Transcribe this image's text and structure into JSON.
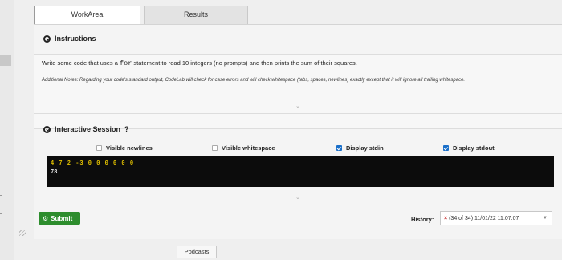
{
  "tabs": [
    {
      "label": "WorkArea",
      "active": true
    },
    {
      "label": "Results",
      "active": false
    }
  ],
  "instructions": {
    "header": "Instructions",
    "text_before": "Write some code that uses a ",
    "code_word": "for",
    "text_after": " statement to read 10 integers (no prompts) and then prints the sum of their squares.",
    "notes": "Additional Notes: Regarding your code's standard output, CodeLab will check for case errors and will check whitespace (tabs, spaces, newlines) exactly except that it will ignore all trailing whitespace."
  },
  "session": {
    "header": "Interactive Session",
    "help": "?",
    "options": [
      {
        "label": "Visible newlines",
        "checked": false
      },
      {
        "label": "Visible whitespace",
        "checked": false
      },
      {
        "label": "Display stdin",
        "checked": true
      },
      {
        "label": "Display stdout",
        "checked": true
      }
    ],
    "terminal": {
      "stdin_line": "4 7 2 -3 0 0 0 0 0 0",
      "stdout_line": "78"
    }
  },
  "submit_label": "Submit",
  "history": {
    "label": "History:",
    "mark": "×",
    "value": "(34 of 34) 11/01/22 11:07:07"
  },
  "footer": {
    "podcasts": "Podcasts"
  },
  "colors": {
    "submit": "#2d8d2d",
    "terminal_bg": "#0c0c0c",
    "stdin": "#e5c300",
    "checkbox": "#1a6fc9",
    "error": "#c62828"
  }
}
